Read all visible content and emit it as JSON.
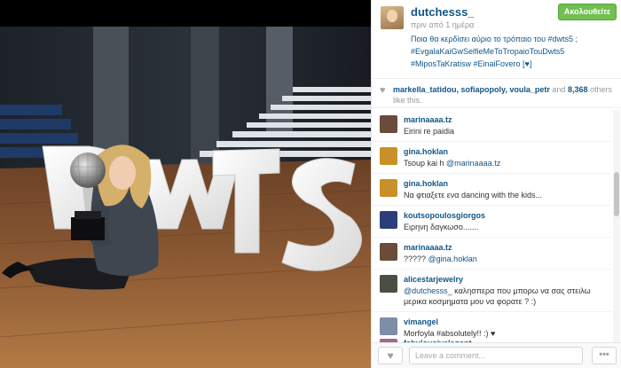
{
  "post": {
    "username": "dutchesss_",
    "time": "πριν από 1 ημέρα",
    "follow_label": "Ακολουθείτε",
    "caption_line1": "Ποια θα κερδίσει αύριο το τρόπαιο του #dwts5 ;",
    "caption_line2": "#EvgalaKaiGwSelfieMeToTropaioTouDwts5",
    "caption_line3": "#MiposTaKratisw #EinaiFovero [♥]",
    "photo_text": "DWTS"
  },
  "likes": {
    "users": "markella_tatidou, sofiapopoly, voula_petr",
    "count_prefix": "and",
    "count": "8,368",
    "suffix": "others like this."
  },
  "comments": [
    {
      "user": "marinaaaa.tz",
      "text": "Eirini re paidia",
      "avatar_color": "#6b4b3a"
    },
    {
      "user": "gina.hoklan",
      "text_before": "Tsoup kai h ",
      "mention": "@marinaaaa.tz",
      "avatar_color": "#c9902a"
    },
    {
      "user": "gina.hoklan",
      "text": "Να φτιαξετε ενα dancing with the kids...",
      "avatar_color": "#c9902a"
    },
    {
      "user": "koutsopoulosgiorgos",
      "text": "Ειρηνη δαγκωσο.......",
      "avatar_color": "#2c3e7a"
    },
    {
      "user": "marinaaaa.tz",
      "text_before": "????? ",
      "mention": "@gina.hoklan",
      "avatar_color": "#6b4b3a"
    },
    {
      "user": "alicestarjewelry",
      "mention": "@dutchesss_",
      "text_after": " καλησπερα που μπορω να σας στειλω",
      "text_line2": "μερικα κοσμηματα μου να φορατε ? :)",
      "avatar_color": "#4a4f46"
    },
    {
      "user": "vimangel",
      "text": "Morfoyla #absolutely!! :) ♥",
      "avatar_color": "#7d8ea6"
    },
    {
      "user": "fabulousivelegant",
      "text": "",
      "avatar_color": "#a06a8a"
    }
  ],
  "footer": {
    "like_icon": "heart-icon",
    "placeholder": "Leave a comment...",
    "more_label": "•••"
  }
}
